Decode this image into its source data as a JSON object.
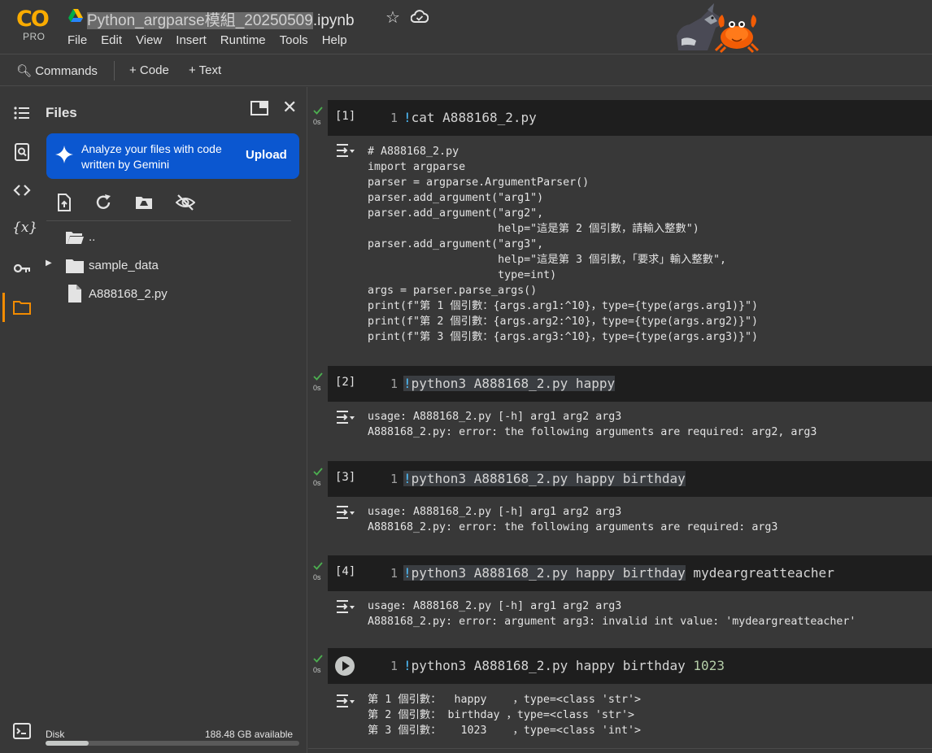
{
  "app": {
    "logo_text": "CO",
    "pro_label": "PRO",
    "title_highlighted": "Python_argparse模組_20250509",
    "title_suffix": ".ipynb"
  },
  "menu": [
    "File",
    "Edit",
    "View",
    "Insert",
    "Runtime",
    "Tools",
    "Help"
  ],
  "toolbar": {
    "commands": "Commands",
    "add_code": "+ Code",
    "add_text": "+ Text"
  },
  "rail_icons": [
    "toc-icon",
    "find-icon",
    "code-snippets-icon",
    "variables-icon",
    "secrets-key-icon",
    "files-folder-icon",
    "terminal-icon"
  ],
  "files_panel": {
    "title": "Files",
    "gemini_text": "Analyze your files with code written by Gemini",
    "gemini_button": "Upload",
    "tree": [
      {
        "label": "..",
        "kind": "parent-folder"
      },
      {
        "label": "sample_data",
        "kind": "folder"
      },
      {
        "label": "A888168_2.py",
        "kind": "file"
      }
    ],
    "disk_label": "Disk",
    "disk_available": "188.48 GB available",
    "disk_used_fraction": 0.17
  },
  "cells": [
    {
      "exec_label": "[1]",
      "time": "0s",
      "line_no": "1",
      "code_parts": [
        [
          "bang",
          "!"
        ],
        [
          "plain",
          "cat A888168_2.py"
        ]
      ],
      "output": "# A888168_2.py\nimport argparse\nparser = argparse.ArgumentParser()\nparser.add_argument(\"arg1\")\nparser.add_argument(\"arg2\",\n                    help=\"這是第 2 個引數，請輸入整數\")\nparser.add_argument(\"arg3\",\n                    help=\"這是第 3 個引數，「要求」輸入整數\",\n                    type=int)\nargs = parser.parse_args()\nprint(f\"第 1 個引數：{args.arg1:^10}，type={type(args.arg1)}\")\nprint(f\"第 2 個引數：{args.arg2:^10}，type={type(args.arg2)}\")\nprint(f\"第 3 個引數：{args.arg3:^10}，type={type(args.arg3)}\")"
    },
    {
      "exec_label": "[2]",
      "time": "0s",
      "line_no": "1",
      "code_parts": [
        [
          "mark-bang",
          "!"
        ],
        [
          "mark",
          "python3 A888168_2.py happy"
        ]
      ],
      "output": "usage: A888168_2.py [-h] arg1 arg2 arg3\nA888168_2.py: error: the following arguments are required: arg2, arg3"
    },
    {
      "exec_label": "[3]",
      "time": "0s",
      "line_no": "1",
      "code_parts": [
        [
          "mark-bang",
          "!"
        ],
        [
          "mark",
          "python3 A888168_2.py happy birthday"
        ]
      ],
      "output": "usage: A888168_2.py [-h] arg1 arg2 arg3\nA888168_2.py: error: the following arguments are required: arg3"
    },
    {
      "exec_label": "[4]",
      "time": "0s",
      "line_no": "1",
      "code_parts": [
        [
          "mark-bang",
          "!"
        ],
        [
          "mark",
          "python3 A888168_2.py happy birthday"
        ],
        [
          "plain",
          " mydeargreatteacher"
        ]
      ],
      "output": "usage: A888168_2.py [-h] arg1 arg2 arg3\nA888168_2.py: error: argument arg3: invalid int value: 'mydeargreatteacher'"
    },
    {
      "exec_label": "",
      "time": "0s",
      "line_no": "1",
      "code_parts": [
        [
          "bang",
          "!"
        ],
        [
          "plain",
          "python3 A888168_2.py happy birthday "
        ],
        [
          "numlit",
          "1023"
        ]
      ],
      "output": "第 1 個引數：  happy    ，type=<class 'str'>\n第 2 個引數： birthday ，type=<class 'str'>\n第 3 個引數：   1023    ，type=<class 'int'>"
    }
  ]
}
